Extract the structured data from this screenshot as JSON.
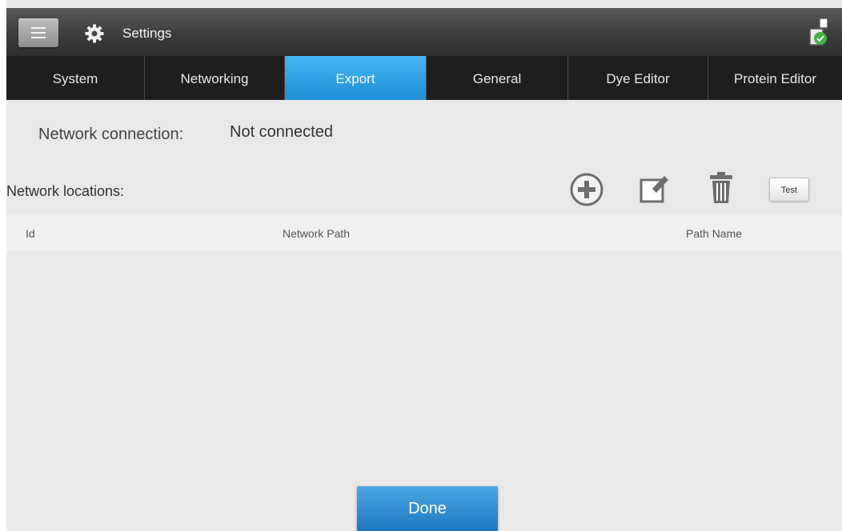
{
  "header": {
    "title": "Settings",
    "menu_icon": "hamburger-menu-icon",
    "settings_icon": "gear-icon",
    "status_icon": "usb-connection-status-icon"
  },
  "tabs": [
    {
      "label": "System",
      "active": false
    },
    {
      "label": "Networking",
      "active": false
    },
    {
      "label": "Export",
      "active": true
    },
    {
      "label": "General",
      "active": false
    },
    {
      "label": "Dye Editor",
      "active": false
    },
    {
      "label": "Protein Editor",
      "active": false
    }
  ],
  "connection": {
    "label": "Network connection:",
    "value": "Not connected"
  },
  "locations": {
    "label": "Network locations:",
    "actions": {
      "add_icon": "add-circle-icon",
      "edit_icon": "edit-icon",
      "delete_icon": "trash-icon",
      "test_label": "Test"
    },
    "columns": [
      "Id",
      "Network Path",
      "Path Name"
    ],
    "rows": []
  },
  "footer": {
    "done_label": "Done"
  },
  "colors": {
    "accent": "#2a9be0",
    "titlebar": "#444444",
    "tabbar": "#1e1e1e",
    "background": "#e9e9e9"
  }
}
